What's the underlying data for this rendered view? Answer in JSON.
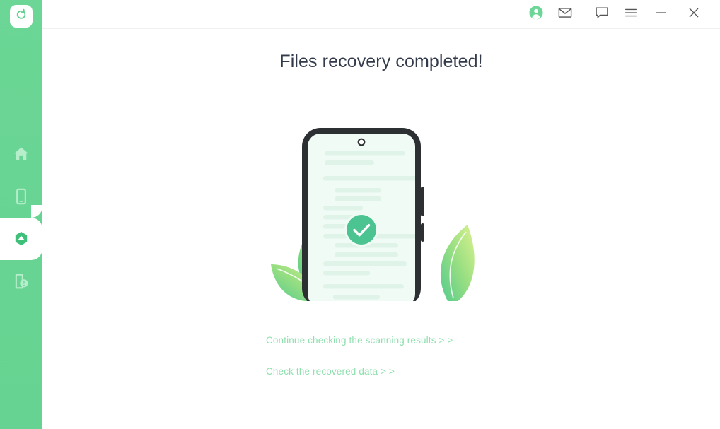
{
  "app": {
    "logo_icon": "recovery-arrow-icon",
    "accent_green": "#6BD696",
    "link_green": "#8fe0ae",
    "title_color": "#333b4a",
    "check_green": "#4CC491"
  },
  "sidebar": {
    "items": [
      {
        "id": "home",
        "icon": "home-icon",
        "active": false
      },
      {
        "id": "device",
        "icon": "smartphone-icon",
        "active": false
      },
      {
        "id": "recover",
        "icon": "cloud-recover-icon",
        "active": true
      },
      {
        "id": "repair",
        "icon": "phone-alert-icon",
        "active": false
      }
    ]
  },
  "header": {
    "tools": [
      {
        "id": "account",
        "icon": "user-avatar-icon"
      },
      {
        "id": "mail",
        "icon": "mail-icon"
      },
      {
        "id": "divider",
        "icon": "vertical-divider"
      },
      {
        "id": "feedback",
        "icon": "chat-bubble-icon"
      },
      {
        "id": "menu",
        "icon": "hamburger-menu-icon"
      },
      {
        "id": "minimize",
        "icon": "minimize-icon"
      },
      {
        "id": "close",
        "icon": "close-icon"
      }
    ]
  },
  "main": {
    "title": "Files recovery completed!",
    "illustration": {
      "name": "phone-recovery-complete-illustration",
      "status_icon": "check-circle-icon"
    },
    "links": [
      {
        "id": "continue-scanning",
        "label": "Continue checking the scanning results > >"
      },
      {
        "id": "check-recovered",
        "label": "Check the recovered data > >"
      }
    ]
  }
}
